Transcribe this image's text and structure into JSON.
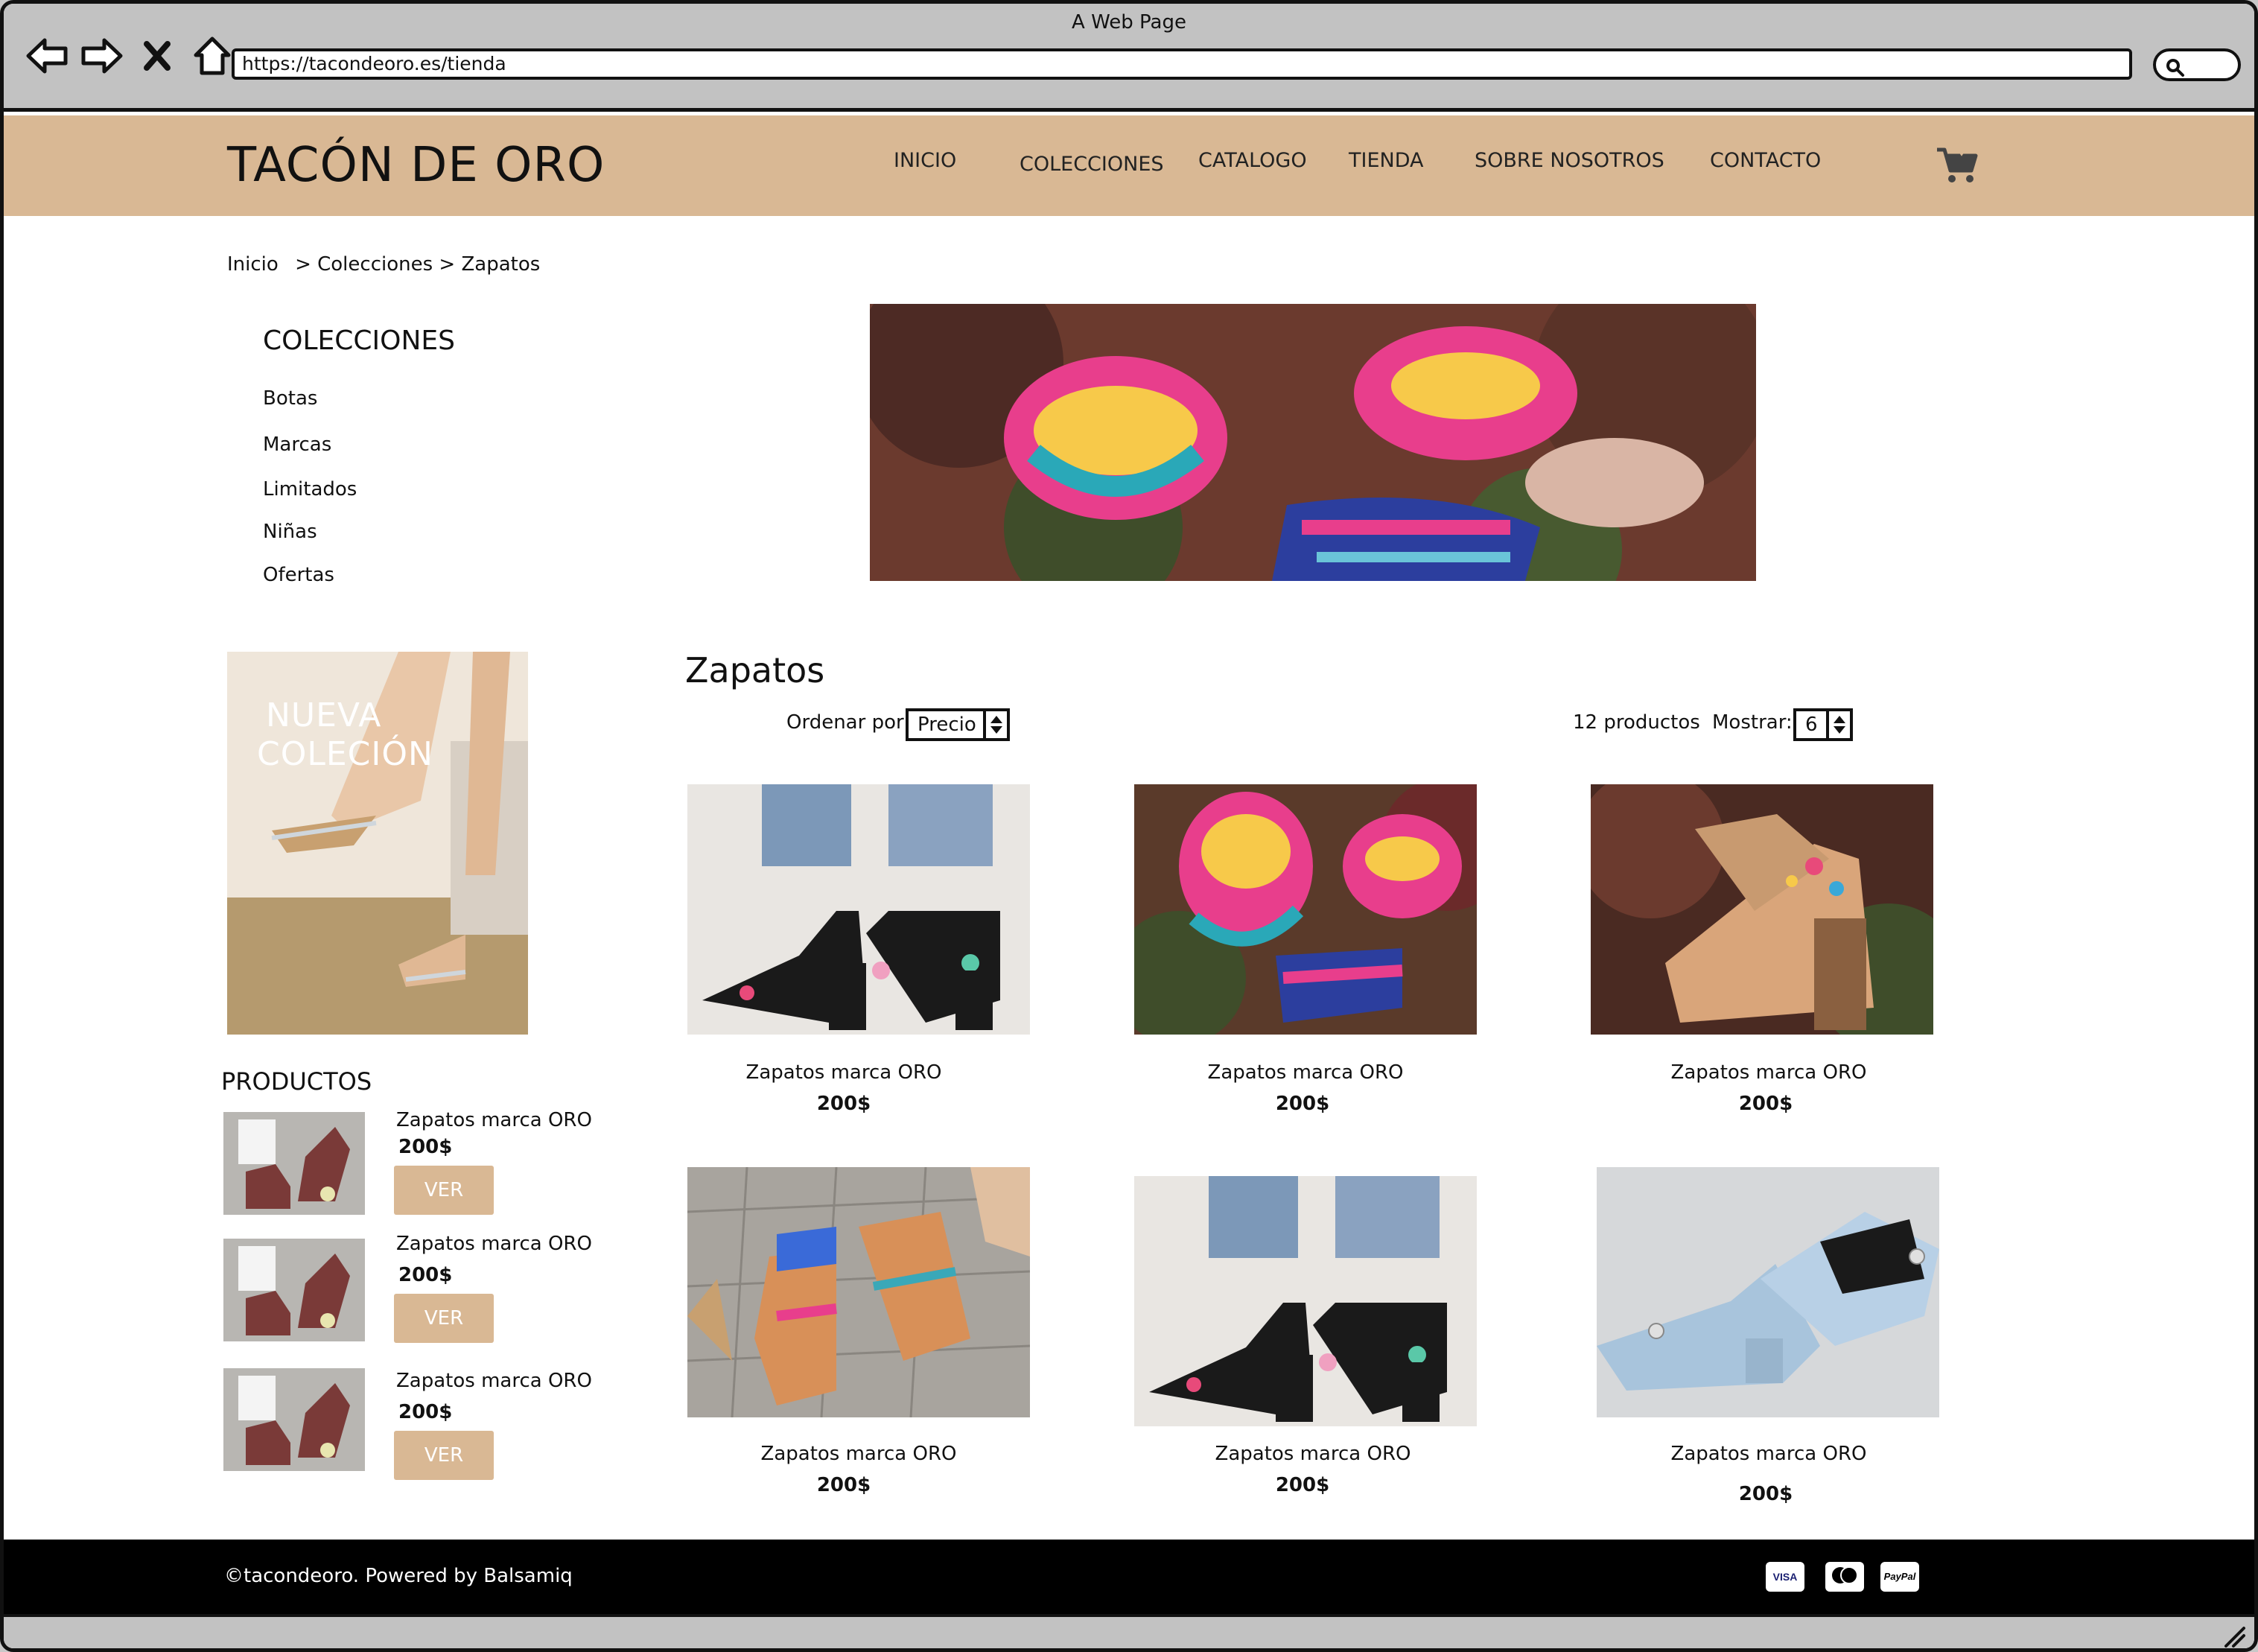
{
  "window": {
    "title": "A Web Page",
    "url": "https://tacondeoro.es/tienda"
  },
  "header": {
    "brand": "TACÓN DE ORO",
    "menu": [
      "INICIO",
      "COLECCIONES",
      "CATALOGO",
      "TIENDA",
      "SOBRE NOSOTROS",
      "CONTACTO"
    ],
    "bg_color": "#d9b894"
  },
  "breadcrumb": {
    "home": "Inicio",
    "sep1": ">",
    "collections": "Colecciones",
    "sep2": ">",
    "current": "Zapatos"
  },
  "sidebar": {
    "title": "COLECCIONES",
    "items": [
      "Botas",
      "Marcas",
      "Limitados",
      "Niñas",
      "Ofertas"
    ],
    "promo": {
      "line1": "NUEVA",
      "line2": "COLECIÓN"
    },
    "products_title": "PRODUCTOS",
    "products": [
      {
        "name": "Zapatos marca ORO",
        "price": "200$",
        "button": "VER"
      },
      {
        "name": "Zapatos marca ORO",
        "price": "200$",
        "button": "VER"
      },
      {
        "name": "Zapatos marca ORO",
        "price": "200$",
        "button": "VER"
      }
    ]
  },
  "main": {
    "title": "Zapatos",
    "sort_label": "Ordenar por:",
    "sort_value": "Precio",
    "count": "12 productos",
    "show_label": "Mostrar:",
    "show_value": "6",
    "products": [
      {
        "name": "Zapatos marca ORO",
        "price": "200$"
      },
      {
        "name": "Zapatos marca ORO",
        "price": "200$"
      },
      {
        "name": "Zapatos marca ORO",
        "price": "200$"
      },
      {
        "name": "Zapatos marca ORO",
        "price": "200$"
      },
      {
        "name": "Zapatos marca ORO",
        "price": "200$"
      },
      {
        "name": "Zapatos marca ORO",
        "price": "200$"
      }
    ]
  },
  "footer": {
    "text": "©tacondeoro. Powered by Balsamiq",
    "payments": [
      "VISA",
      "mastercard",
      "PayPal"
    ]
  }
}
